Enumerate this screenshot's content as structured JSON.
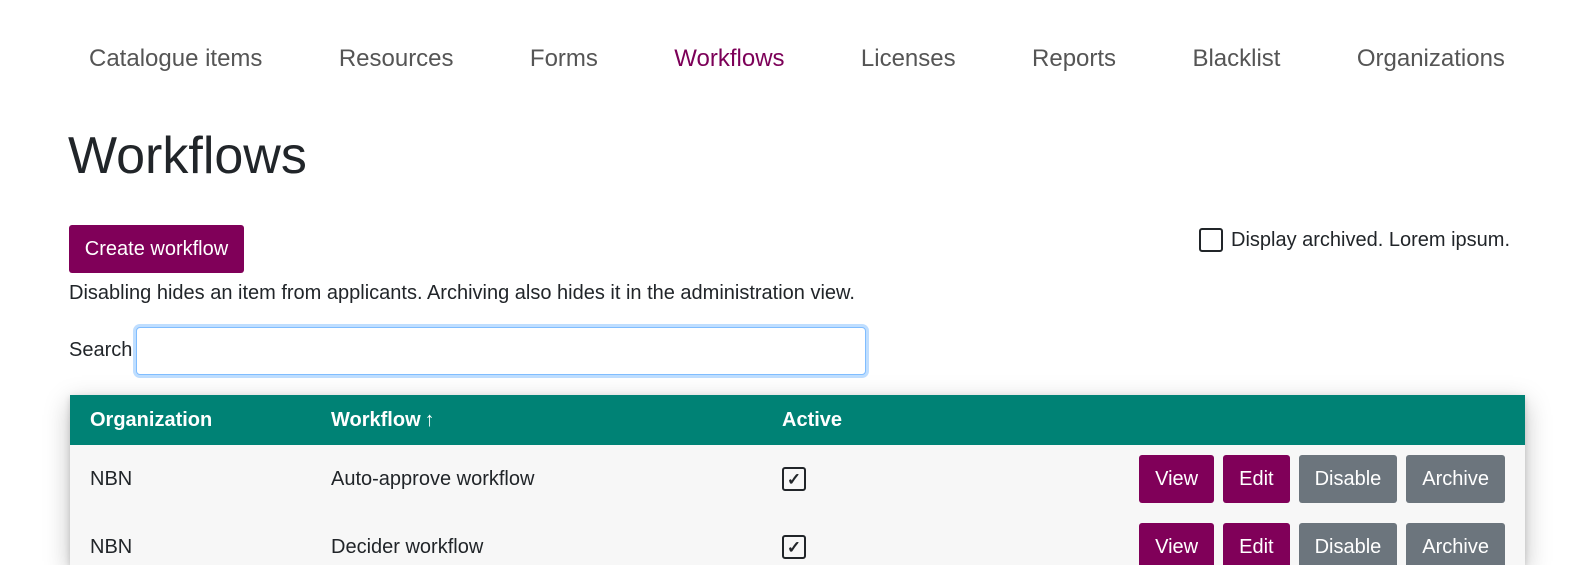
{
  "nav": {
    "items": [
      {
        "label": "Catalogue items"
      },
      {
        "label": "Resources"
      },
      {
        "label": "Forms"
      },
      {
        "label": "Workflows"
      },
      {
        "label": "Licenses"
      },
      {
        "label": "Reports"
      },
      {
        "label": "Blacklist"
      },
      {
        "label": "Organizations"
      }
    ],
    "active": "Workflows"
  },
  "page": {
    "title": "Workflows",
    "create_button": "Create workflow",
    "archived_toggle_label": "Display archived. Lorem ipsum.",
    "archived_checked": false,
    "help_text": "Disabling hides an item from applicants. Archiving also hides it in the administration view.",
    "search_label": "Search",
    "search_value": ""
  },
  "table": {
    "headers": {
      "organization": "Organization",
      "workflow": "Workflow",
      "sort_icon": "↑",
      "active": "Active"
    },
    "rows": [
      {
        "organization": "NBN",
        "workflow": "Auto-approve workflow",
        "active": true
      },
      {
        "organization": "NBN",
        "workflow": "Decider workflow",
        "active": true
      }
    ],
    "actions": {
      "view": "View",
      "edit": "Edit",
      "disable": "Disable",
      "archive": "Archive"
    }
  },
  "colors": {
    "accent": "#800059",
    "table_header": "#008275",
    "secondary_button": "#6c757d"
  }
}
